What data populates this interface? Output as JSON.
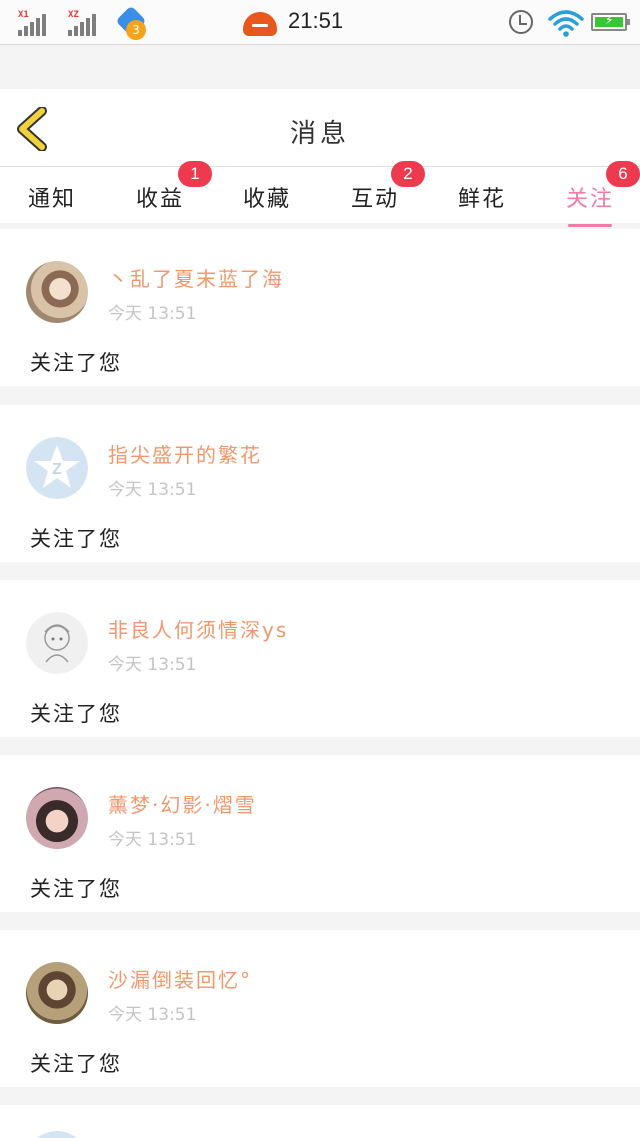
{
  "status_bar": {
    "sim1_tag": "X1",
    "sim2_tag": "XZ",
    "notification_count": "3",
    "time": "21:51"
  },
  "header": {
    "title": "消息"
  },
  "tabs": [
    {
      "label": "通知",
      "badge": ""
    },
    {
      "label": "收益",
      "badge": "1"
    },
    {
      "label": "收藏",
      "badge": ""
    },
    {
      "label": "互动",
      "badge": "2"
    },
    {
      "label": "鲜花",
      "badge": ""
    },
    {
      "label": "关注",
      "badge": "6",
      "active": true
    }
  ],
  "messages": [
    {
      "username": "丶乱了夏末蓝了海",
      "time": "今天 13:51",
      "action": "关注了您",
      "avatar": "photo-girl-icon"
    },
    {
      "username": "指尖盛开的繁花",
      "time": "今天 13:51",
      "action": "关注了您",
      "avatar": "default-star-avatar-icon"
    },
    {
      "username": "非良人何须情深ys",
      "time": "今天 13:51",
      "action": "关注了您",
      "avatar": "sketch-anime-icon"
    },
    {
      "username": "薰梦·幻影·熠雪",
      "time": "今天 13:51",
      "action": "关注了您",
      "avatar": "photo-girl-icon"
    },
    {
      "username": "沙漏倒装回忆°",
      "time": "今天 13:51",
      "action": "关注了您",
      "avatar": "photo-girl-icon"
    }
  ],
  "colors": {
    "accent": "#ef7ba7",
    "username": "#f0986c",
    "badge": "#ee3a4e",
    "back_arrow": "#f2d23c"
  }
}
